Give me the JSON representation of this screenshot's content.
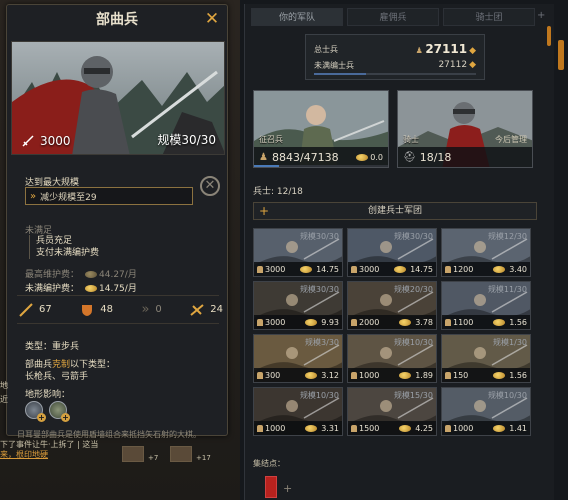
{
  "detail": {
    "title": "部曲兵",
    "close": "✕",
    "attack": "3000",
    "scale": "规模30/30",
    "max_title": "达到最大规模",
    "reduce_label": "减少规模至29",
    "unsatisfied": "未满足",
    "req1": "兵员充足",
    "req2": "支付未满编护费",
    "maint1_label": "最高维护费：",
    "maint1_value": "44.27/月",
    "maint2_label": "未满编护费：",
    "maint2_value": "14.75/月",
    "stats": {
      "melee": "67",
      "shield": "48",
      "ranged": "0",
      "charge": "24"
    },
    "type_line": "类型：重步兵",
    "counter_prefix": "部曲兵",
    "counter_word": "克制",
    "counter_suffix": "以下类型：",
    "counter_values": "长枪兵、弓箭手",
    "terrain_title": "地形影响：",
    "description": "日耳曼部曲兵是使用盾墙组合来抵挡矢石射的大棋。"
  },
  "left_bottom": {
    "line1": "下了事件让牛·上拆了 | 这当",
    "link": "来，根印地硬",
    "num1": "+7",
    "num2": "+17",
    "edge_a": "地",
    "edge_b": "近"
  },
  "army": {
    "tabs": [
      "你的军队",
      "雇佣兵",
      "骑士团"
    ],
    "tab_extra": "+",
    "total_label": "总士兵",
    "total_value": "27111",
    "unfilled_label": "未满编士兵",
    "unfilled_value": "27112",
    "levy": {
      "label": "征召兵",
      "value": "8843/47138",
      "cost": "0.0",
      "fill": 0.19
    },
    "knights": {
      "label": "骑士",
      "value": "18/18",
      "note": "今后管理"
    },
    "soldier_label": "兵士: 12/18",
    "create_label": "创建兵士军团",
    "units": [
      {
        "scale": "规模30/30",
        "count": "3000",
        "cost": "14.75",
        "tone": "#57606c"
      },
      {
        "scale": "规模30/30",
        "count": "3000",
        "cost": "14.75",
        "tone": "#4e5866"
      },
      {
        "scale": "规模12/30",
        "count": "1200",
        "cost": "3.40",
        "tone": "#5b6470"
      },
      {
        "scale": "规模30/30",
        "count": "3000",
        "cost": "9.93",
        "tone": "#3e3a34"
      },
      {
        "scale": "规模20/30",
        "count": "2000",
        "cost": "3.78",
        "tone": "#4a4238"
      },
      {
        "scale": "规模11/30",
        "count": "1100",
        "cost": "1.56",
        "tone": "#505864"
      },
      {
        "scale": "规模3/30",
        "count": "300",
        "cost": "3.12",
        "tone": "#6a5a40"
      },
      {
        "scale": "规模10/30",
        "count": "1000",
        "cost": "1.89",
        "tone": "#5e5444"
      },
      {
        "scale": "规模1/30",
        "count": "150",
        "cost": "1.56",
        "tone": "#625a48"
      },
      {
        "scale": "规模10/30",
        "count": "1000",
        "cost": "3.31",
        "tone": "#3c3630"
      },
      {
        "scale": "规模15/30",
        "count": "1500",
        "cost": "4.25",
        "tone": "#4c4640"
      },
      {
        "scale": "规模10/30",
        "count": "1000",
        "cost": "1.41",
        "tone": "#545c66"
      }
    ],
    "rally_label": "集结点："
  }
}
